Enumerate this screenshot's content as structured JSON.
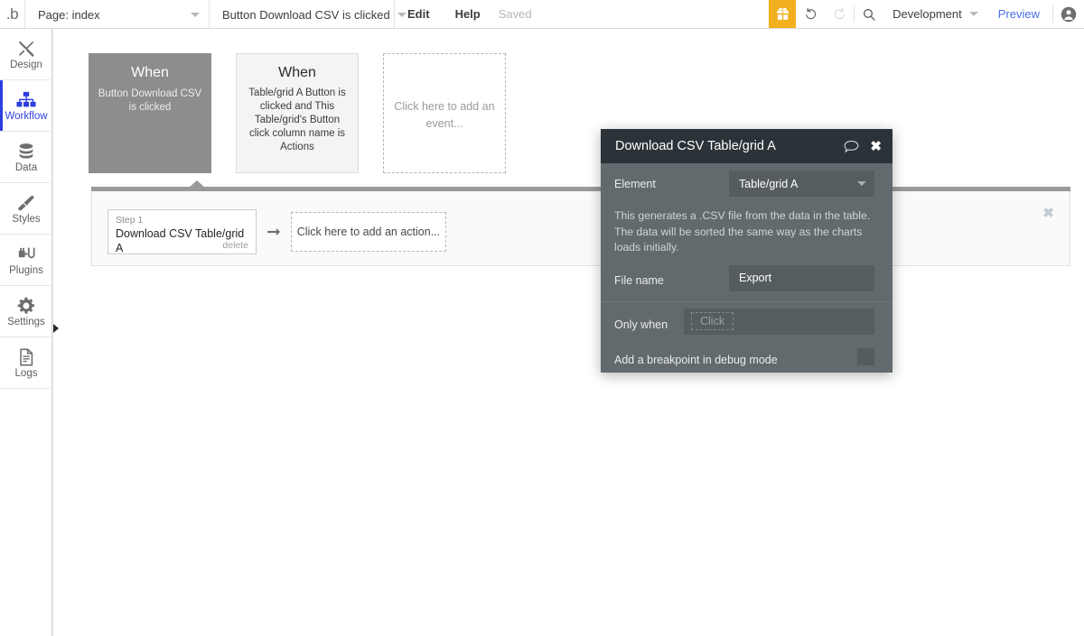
{
  "topbar": {
    "logo": ".b",
    "page_selector": {
      "label": "Page: index",
      "icon": "chevron-down-icon"
    },
    "event_selector": {
      "label": "Button Download CSV is clicked",
      "icon": "chevron-down-icon"
    },
    "edit": "Edit",
    "help": "Help",
    "saved": "Saved",
    "gift_icon": "gift-icon",
    "undo_icon": "undo-icon",
    "redo_icon": "redo-icon",
    "search_icon": "search-icon",
    "version": "Development",
    "preview": "Preview",
    "avatar_icon": "user-avatar-icon",
    "gift_color": "#f2b01e",
    "preview_color": "#4a6fe8"
  },
  "sidebar": {
    "active_color": "#2c3ee0",
    "items": [
      {
        "label": "Design",
        "icon": "design-pencil-ruler-icon",
        "active": false
      },
      {
        "label": "Workflow",
        "icon": "workflow-orgchart-icon",
        "active": true
      },
      {
        "label": "Data",
        "icon": "data-database-icon",
        "active": false
      },
      {
        "label": "Styles",
        "icon": "styles-paintbrush-icon",
        "active": false
      },
      {
        "label": "Plugins",
        "icon": "plugins-plug-icon",
        "active": false
      },
      {
        "label": "Settings",
        "icon": "settings-gear-icon",
        "active": false
      },
      {
        "label": "Logs",
        "icon": "logs-document-icon",
        "active": false
      }
    ],
    "collapse_icon": "collapse-right-arrow-icon"
  },
  "workflow": {
    "events": [
      {
        "when": "When",
        "desc": "Button Download CSV is clicked",
        "state": "selected"
      },
      {
        "when": "When",
        "desc": "Table/grid A Button is clicked and This Table/grid's Button click column name is Actions",
        "state": "plain"
      },
      {
        "add_label": "Click here to add an event...",
        "state": "add"
      }
    ],
    "actions": {
      "step_number": "Step 1",
      "step_title": "Download CSV Table/grid A",
      "delete_label": "delete",
      "arrow_icon": "arrow-right-icon",
      "add_action_label": "Click here to add an action...",
      "close_icon": "close-icon"
    }
  },
  "property_editor": {
    "title": "Download CSV Table/grid A",
    "comment_icon": "comment-bubble-icon",
    "close_icon": "close-icon",
    "element_label": "Element",
    "element_value": "Table/grid A",
    "element_caret": "chevron-down-icon",
    "description": "This generates a .CSV file from the data in the table. The data will be sorted the same way as the charts loads initially.",
    "filename_label": "File name",
    "filename_value": "Export",
    "onlywhen_label": "Only when",
    "onlywhen_placeholder": "Click",
    "breakpoint_label": "Add a breakpoint in debug mode",
    "breakpoint_checked": false
  }
}
